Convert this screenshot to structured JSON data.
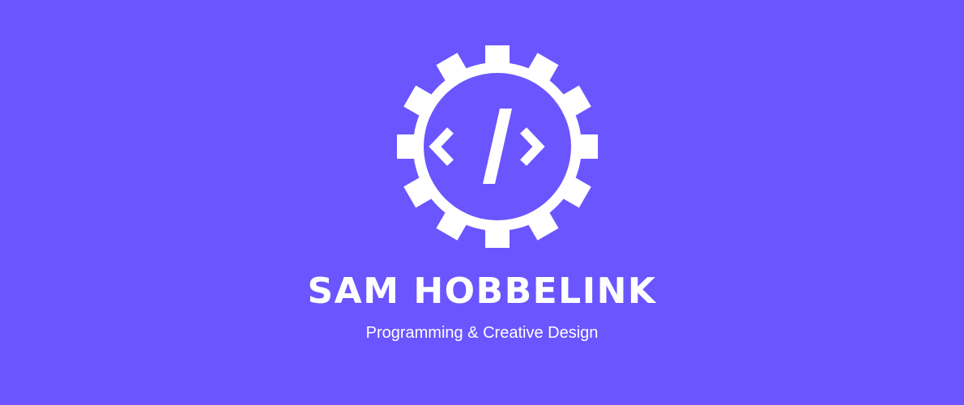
{
  "brand": {
    "name": "SAM HOBBELINK",
    "tagline": "Programming & Creative Design",
    "logo_icon": "gear-code-icon"
  },
  "colors": {
    "background": "#6a55ff",
    "foreground": "#ffffff"
  }
}
